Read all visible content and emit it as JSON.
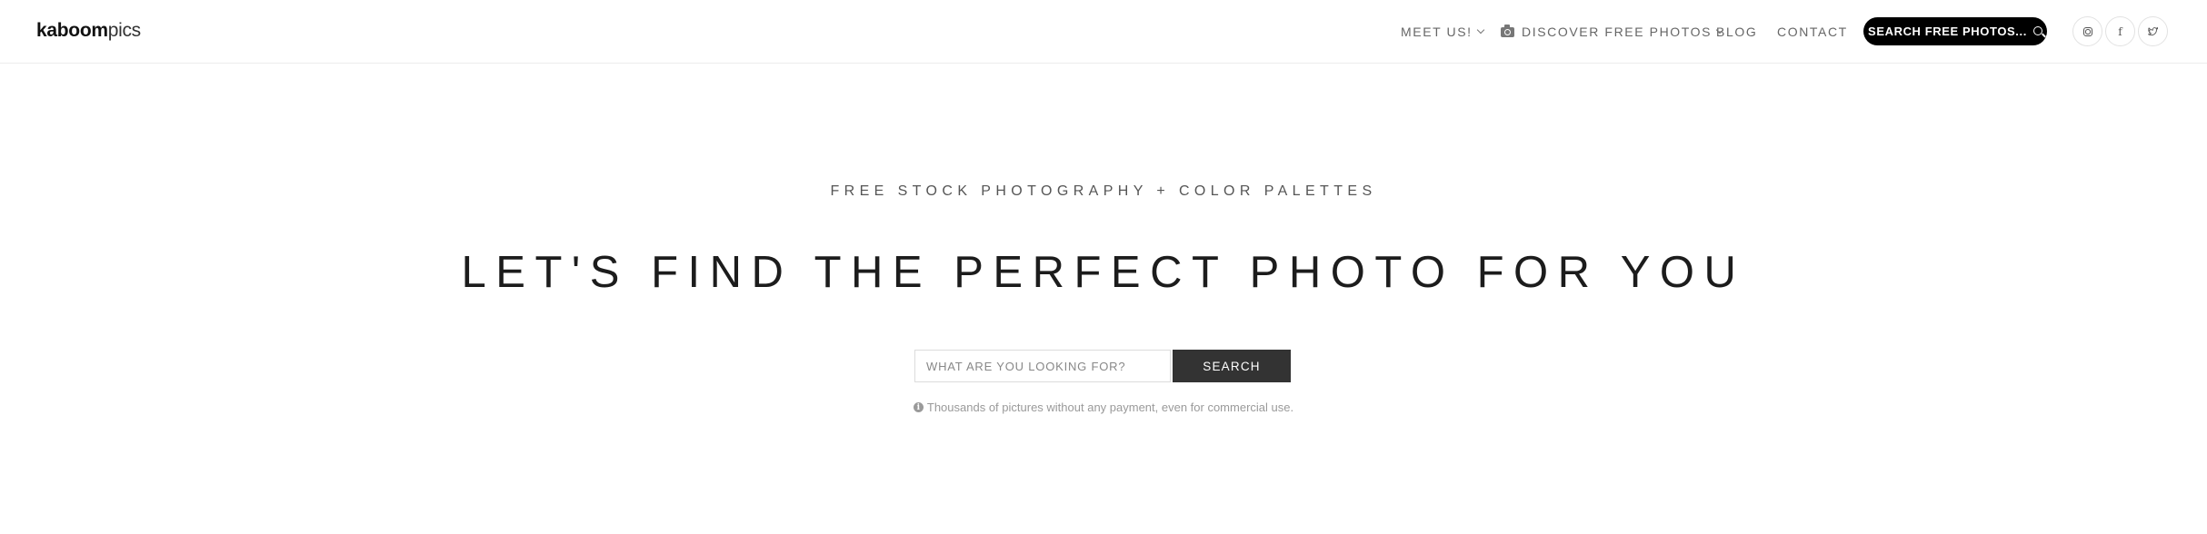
{
  "header": {
    "logo_bold": "kaboom",
    "logo_light": "pics",
    "nav": {
      "meet_us": "MEET US!",
      "discover": "DISCOVER FREE PHOTOS",
      "blog": "BLOG",
      "contact": "CONTACT"
    },
    "search_button": "SEARCH FREE PHOTOS...",
    "social": {
      "facebook_glyph": "f",
      "twitter_glyph": "✧"
    },
    "icons": [
      "chevron-down-icon",
      "camera-icon",
      "search-icon",
      "instagram-icon",
      "facebook-icon",
      "twitter-icon"
    ]
  },
  "hero": {
    "subtitle": "FREE STOCK PHOTOGRAPHY + COLOR PALETTES",
    "title": "LET'S FIND THE PERFECT PHOTO FOR YOU"
  },
  "search": {
    "placeholder": "WHAT ARE YOU LOOKING FOR?",
    "value": "",
    "button": "SEARCH"
  },
  "note": {
    "icon_glyph": "i",
    "text": "Thousands of pictures without any payment, even for commercial use."
  },
  "colors": {
    "accent_dark": "#000000",
    "button_dark": "#333333",
    "muted_text": "#9a9a9a"
  }
}
